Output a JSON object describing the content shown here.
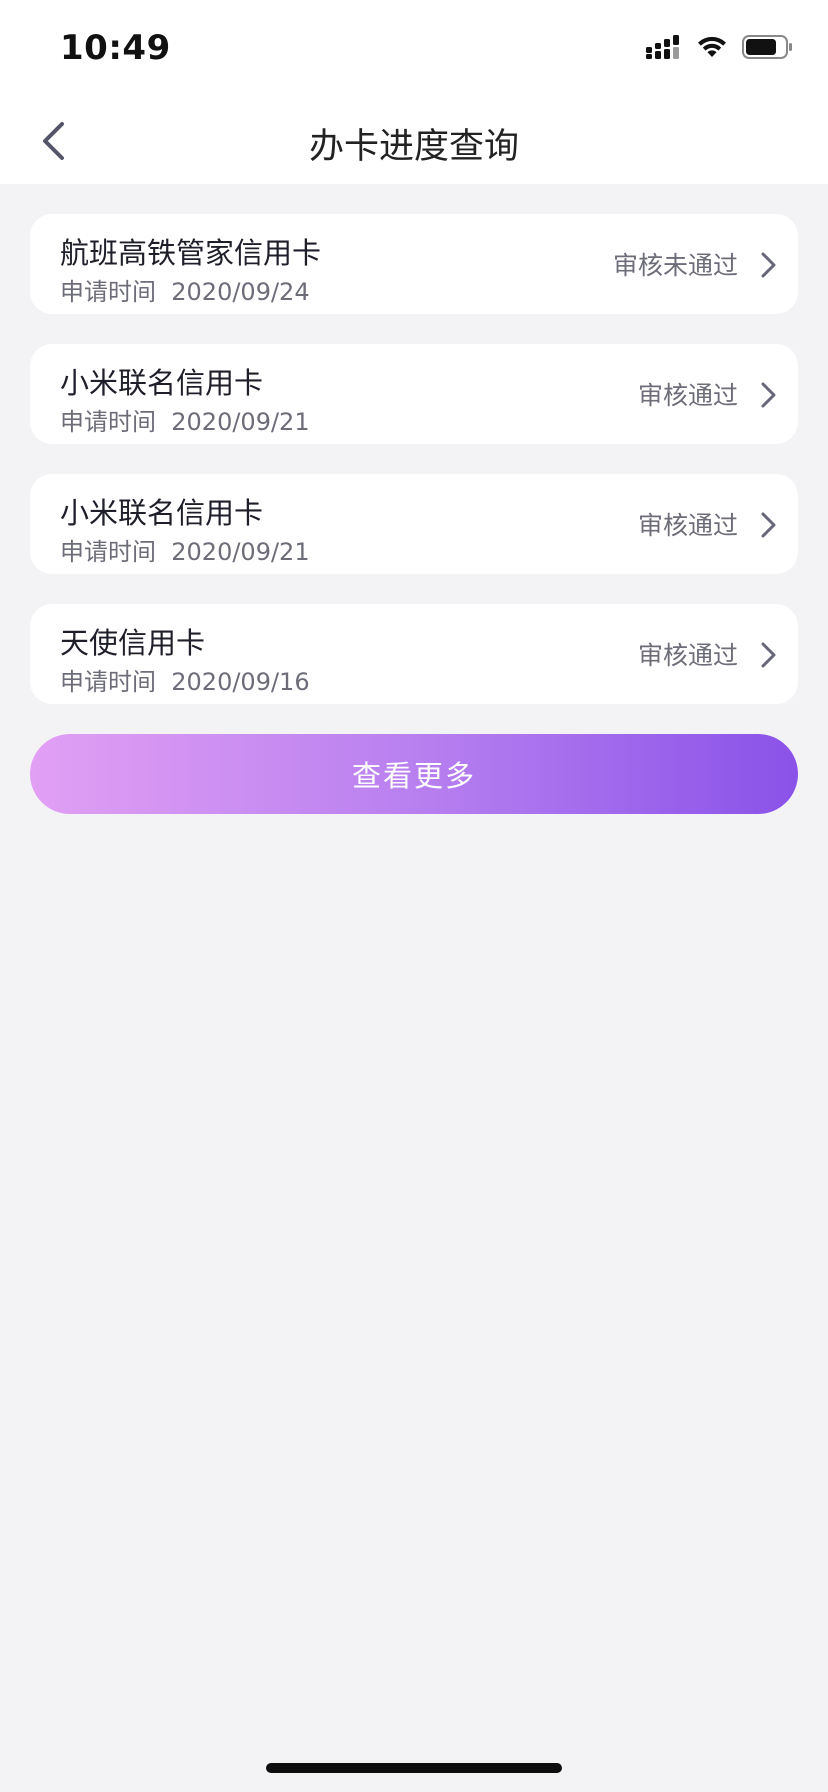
{
  "status_bar": {
    "time": "10:49",
    "icons": [
      "cellular-signal-icon",
      "wifi-icon",
      "battery-icon"
    ]
  },
  "nav": {
    "title": "办卡进度查询",
    "back_icon": "chevron-left-icon"
  },
  "cards": [
    {
      "name": "航班高铁管家信用卡",
      "date_label": "申请时间",
      "date": "2020/09/24",
      "status": "审核未通过"
    },
    {
      "name": "小米联名信用卡",
      "date_label": "申请时间",
      "date": "2020/09/21",
      "status": "审核通过"
    },
    {
      "name": "小米联名信用卡",
      "date_label": "申请时间",
      "date": "2020/09/21",
      "status": "审核通过"
    },
    {
      "name": "天使信用卡",
      "date_label": "申请时间",
      "date": "2020/09/16",
      "status": "审核通过"
    }
  ],
  "more_button": {
    "label": "查看更多"
  },
  "colors": {
    "background": "#f3f3f6",
    "card": "#ffffff",
    "gradient_start": "#e2a0f4",
    "gradient_end": "#8a52e8",
    "secondary_text": "#6d6d7a"
  }
}
